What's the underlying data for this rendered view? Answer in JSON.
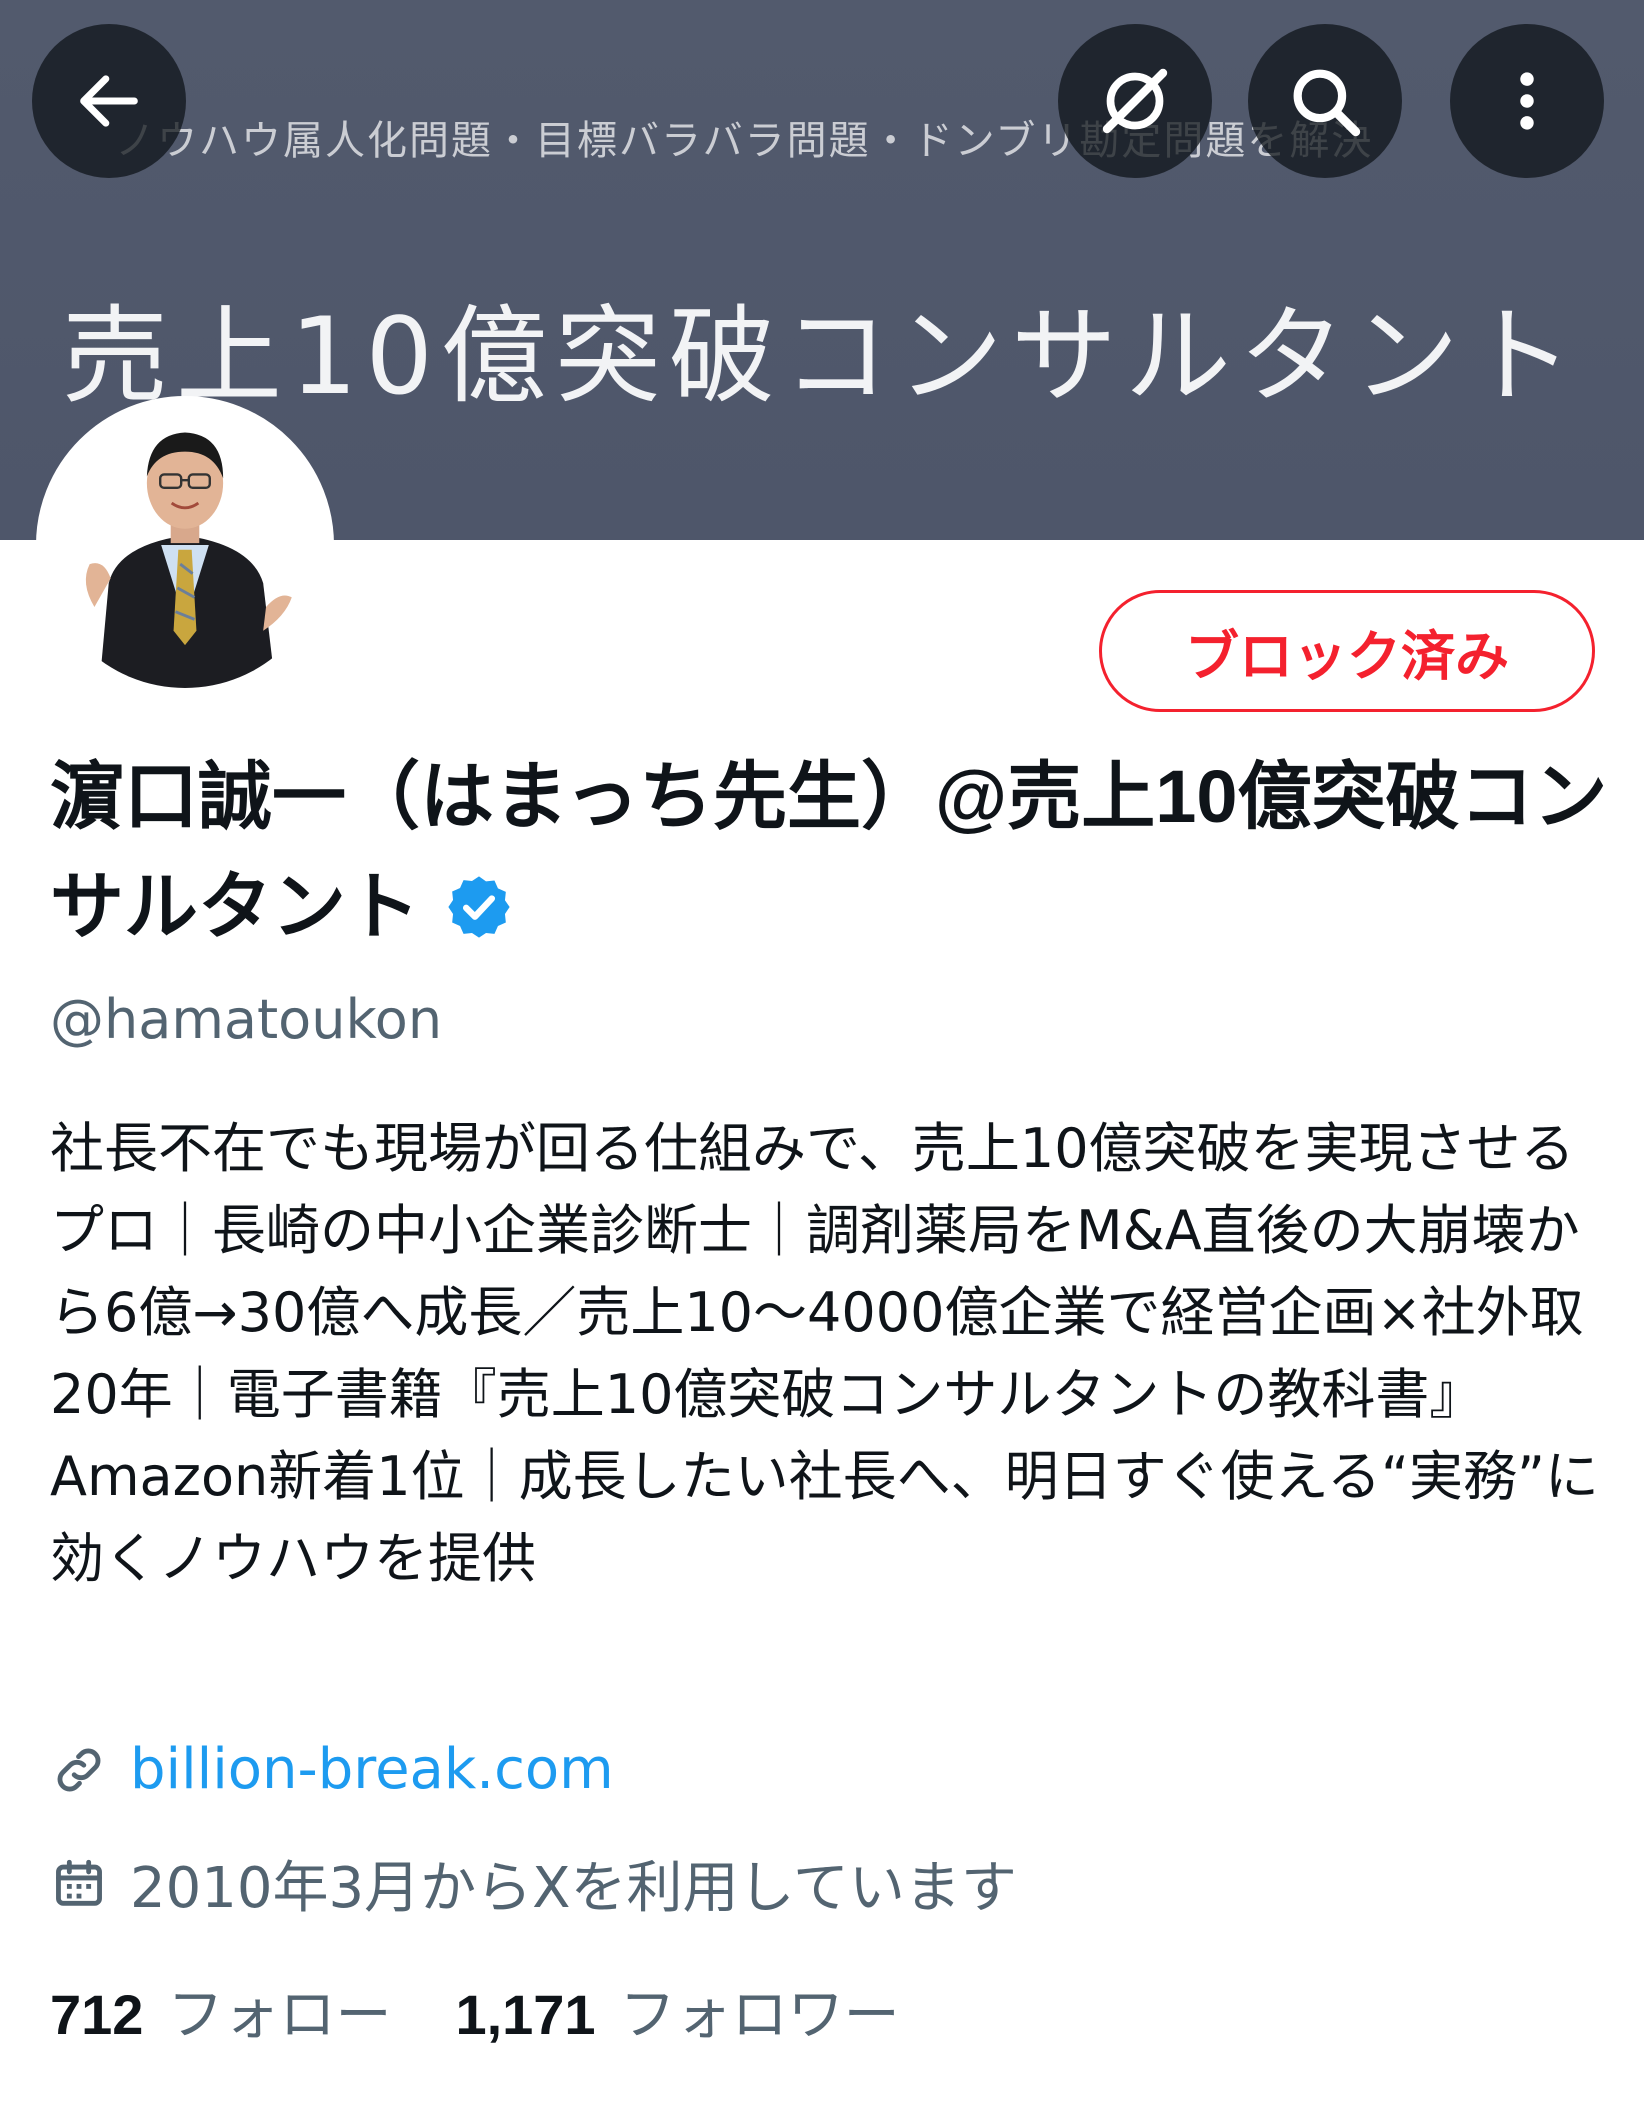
{
  "banner": {
    "tagline": "ノウハウ属人化問題・目標バラバラ問題・ドンブリ勘定問題を解決",
    "title": "売上10億突破コンサルタント"
  },
  "header_buttons": {
    "back": "back-arrow-icon",
    "grok": "grok-icon",
    "search": "search-icon",
    "more": "more-vertical-icon"
  },
  "profile": {
    "block_label": "ブロック済み",
    "name": "濵口誠一（はまっち先生）@売上10億突破コンサルタント",
    "handle": "@hamatoukon",
    "bio": "社長不在でも現場が回る仕組みで、売上10億突破を実現させるプロ｜長崎の中小企業診断士｜調剤薬局をM&A直後の大崩壊から6億→30億へ成長／売上10〜4000億企業で経営企画×社外取20年｜電子書籍『売上10億突破コンサルタントの教科書』Amazon新着1位｜成長したい社長へ、明日すぐ使える“実務”に効くノウハウを提供",
    "link": "billion-break.com",
    "joined": "2010年3月からXを利用しています",
    "following_count": "712",
    "following_label": "フォロー",
    "followers_count": "1,171",
    "followers_label": "フォロワー"
  },
  "colors": {
    "banner": "#525a6d",
    "block_red": "#f4212e",
    "link_blue": "#1d9bf0",
    "secondary_text": "#536471"
  }
}
